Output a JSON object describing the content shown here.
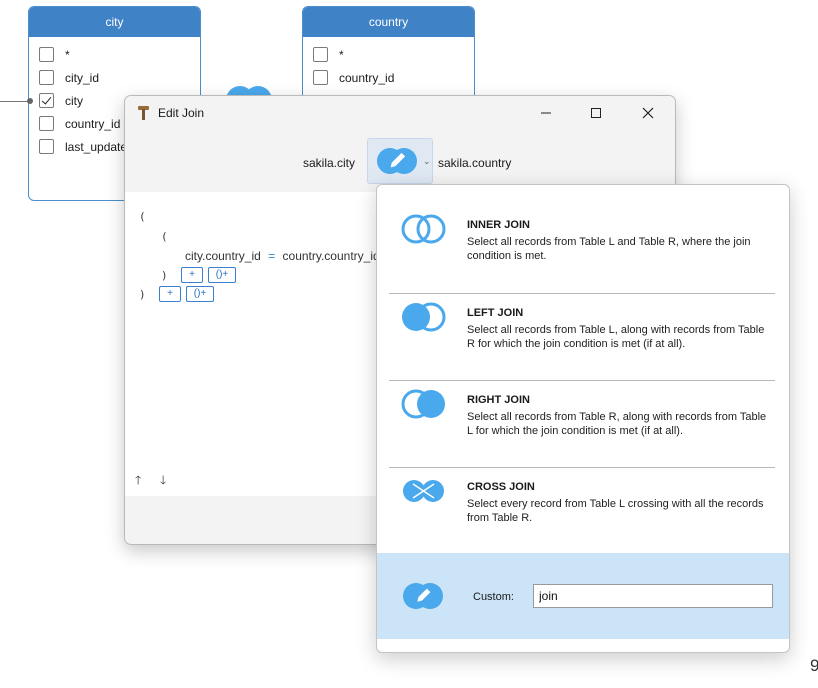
{
  "city_table": {
    "title": "city",
    "fields": [
      {
        "label": "*",
        "checked": false
      },
      {
        "label": "city_id",
        "checked": false
      },
      {
        "label": "city",
        "checked": true
      },
      {
        "label": "country_id",
        "checked": false
      },
      {
        "label": "last_update",
        "checked": false
      }
    ]
  },
  "country_table": {
    "title": "country",
    "fields": [
      {
        "label": "*",
        "checked": false
      },
      {
        "label": "country_id",
        "checked": false
      }
    ]
  },
  "dialog": {
    "title": "Edit Join",
    "minimize_icon": "minimize-icon",
    "maximize_icon": "maximize-icon",
    "close_icon": "close-icon",
    "left_table": "sakila.city",
    "right_table": "sakila.country"
  },
  "editor": {
    "open1": "(",
    "open2": "(",
    "condition_left": "city.country_id",
    "condition_op": "=",
    "condition_right": "country.country_id",
    "close2": ")",
    "close1": ")",
    "add_label": "+",
    "add_group_label": "()+",
    "move_up": "🡑",
    "move_down": "🡓"
  },
  "join_menu": {
    "options": [
      {
        "name": "INNER JOIN",
        "description": "Select all records from Table L and Table R, where the join condition is met."
      },
      {
        "name": "LEFT JOIN",
        "description": "Select all records from Table L, along with records from Table R for which the join condition is met (if at all)."
      },
      {
        "name": "RIGHT JOIN",
        "description": "Select all records from Table R, along with records from Table L for which the join condition is met (if at all)."
      },
      {
        "name": "CROSS JOIN",
        "description": "Select every record from Table L crossing with all the records from Table R."
      }
    ],
    "custom_label": "Custom:",
    "custom_value": "join"
  },
  "colors": {
    "accent": "#3f82c6",
    "join_blue": "#4aa8ec",
    "custom_highlight": "#cce4f7"
  },
  "stray_text": "9"
}
